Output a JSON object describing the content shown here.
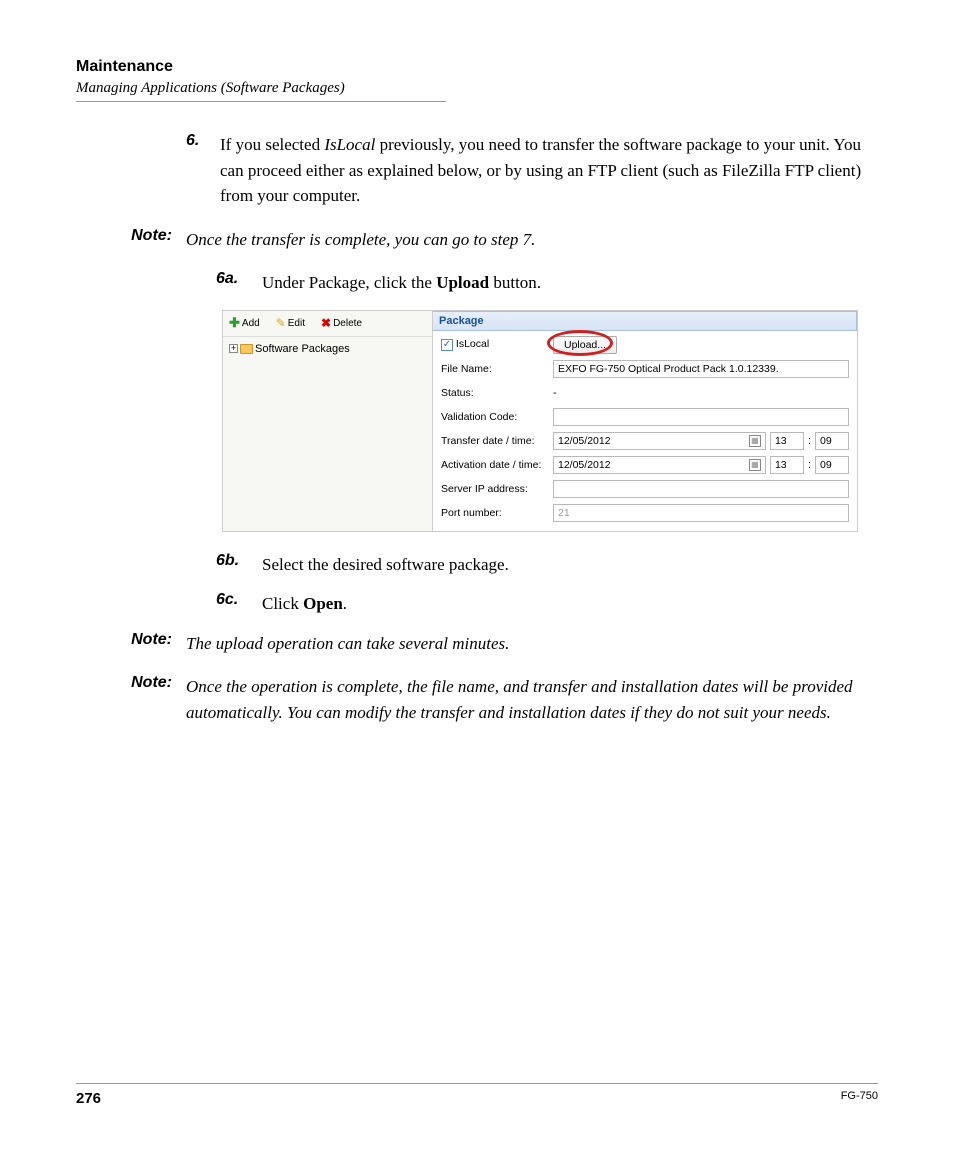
{
  "header": {
    "title": "Maintenance",
    "subtitle": "Managing Applications (Software Packages)"
  },
  "step6": {
    "num": "6.",
    "text_a": "If you selected ",
    "text_b": "IsLocal",
    "text_c": " previously, you need to transfer the software package to your unit. You can proceed either as explained below, or by using an FTP client (such as FileZilla FTP client) from your computer."
  },
  "note1": {
    "label": "Note:",
    "text": "Once the transfer is complete, you can go to step 7."
  },
  "step6a": {
    "num": "6a.",
    "t1": "Under Package, click the ",
    "t2": "Upload",
    "t3": " button."
  },
  "app": {
    "toolbar": {
      "add": "Add",
      "edit": "Edit",
      "del": "Delete"
    },
    "tree": {
      "root": "Software Packages"
    },
    "panel_title": "Package",
    "labels": {
      "islocal": "IsLocal",
      "filename": "File Name:",
      "status": "Status:",
      "validation": "Validation Code:",
      "transfer": "Transfer date / time:",
      "activation": "Activation date / time:",
      "serverip": "Server IP address:",
      "port": "Port number:"
    },
    "upload_btn": "Upload...",
    "values": {
      "filename": "EXFO FG-750 Optical Product Pack 1.0.12339.",
      "status": "-",
      "validation": "",
      "transfer_date": "12/05/2012",
      "transfer_hh": "13",
      "transfer_mm": "09",
      "activation_date": "12/05/2012",
      "activation_hh": "13",
      "activation_mm": "09",
      "serverip": "",
      "port": "21"
    }
  },
  "step6b": {
    "num": "6b.",
    "text": "Select the desired software package."
  },
  "step6c": {
    "num": "6c.",
    "t1": "Click ",
    "t2": "Open",
    "t3": "."
  },
  "note2": {
    "label": "Note:",
    "text": "The upload operation can take several minutes."
  },
  "note3": {
    "label": "Note:",
    "text": "Once the operation is complete, the file name, and transfer and installation dates will be provided automatically. You can modify the transfer and installation dates if they do not suit your needs."
  },
  "footer": {
    "page": "276",
    "doc": "FG-750"
  }
}
